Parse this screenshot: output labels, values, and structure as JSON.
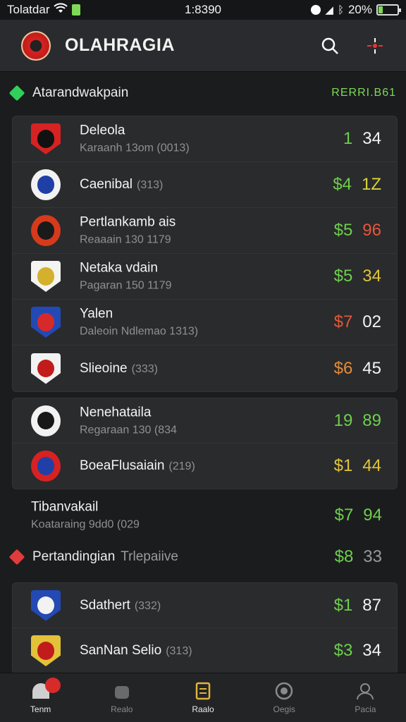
{
  "status_bar": {
    "carrier": "Tolatdar",
    "time": "1:8390",
    "battery": "20%",
    "battery_level": 0.2
  },
  "header": {
    "title": "OLAHRAGIA"
  },
  "sections": [
    {
      "title": "Atarandwakpain",
      "note": "RERRI.B61",
      "color": "#2fd15a"
    },
    {
      "title": "Pertandingian",
      "subtitle": "Trlepaiive",
      "color": "#e23b3b"
    }
  ],
  "group1": [
    {
      "name": "Deleola",
      "sub": "Karaanh 13om (0013)",
      "s1": "1",
      "s2": "34",
      "c1": "#6ccf4c",
      "c2": "#f4f4f4",
      "b1": "#d62222",
      "b2": "#111111",
      "shape": "shield"
    },
    {
      "name": "Caenibal",
      "count": "(313)",
      "s1": "$4",
      "s2": "1Z",
      "c1": "#6ccf4c",
      "c2": "#d8d438",
      "b1": "#f2f2f2",
      "b2": "#1f3fa6",
      "shape": "round"
    },
    {
      "name": "Pertlankamb ais",
      "sub": "Reaaain 130 1179",
      "s1": "$5",
      "s2": "96",
      "c1": "#6ccf4c",
      "c2": "#e4573a",
      "b1": "#d63a1c",
      "b2": "#1a1a1a",
      "shape": "round"
    },
    {
      "name": "Netaka vdain",
      "sub": "Pagaran 150 1179",
      "s1": "$5",
      "s2": "34",
      "c1": "#6ccf4c",
      "c2": "#e0c53a",
      "b1": "#f4f4f0",
      "b2": "#d4b02c",
      "shape": "shield"
    },
    {
      "name": "Yalen",
      "sub": "Daleoin Ndlemao 1313)",
      "s1": "$7",
      "s2": "02",
      "c1": "#e4573a",
      "c2": "#f4f4f4",
      "b1": "#2349b5",
      "b2": "#d62a2a",
      "shape": "shield"
    },
    {
      "name": "Slieoine",
      "count": "(333)",
      "s1": "$6",
      "s2": "45",
      "c1": "#e38b3a",
      "c2": "#f4f4f4",
      "b1": "#f2f2f2",
      "b2": "#c21b1b",
      "shape": "shield"
    }
  ],
  "group2": [
    {
      "name": "Nenehataila",
      "sub": "Regaraan 130 (834",
      "s1": "19",
      "s2": "89",
      "c1": "#6ccf4c",
      "c2": "#6ccf4c",
      "b1": "#f2f2f2",
      "b2": "#181818",
      "shape": "round"
    },
    {
      "name": "BoeaFlusaiain",
      "count": "(219)",
      "s1": "$1",
      "s2": "44",
      "c1": "#e0c53a",
      "c2": "#e0c53a",
      "b1": "#d62222",
      "b2": "#2040a8",
      "shape": "round"
    }
  ],
  "single": {
    "name": "Tibanvakail",
    "sub": "Koataraing 9dd0 (029",
    "s1": "$7",
    "s2": "94",
    "c1": "#6ccf4c",
    "c2": "#6ccf4c"
  },
  "section2_score": {
    "s1": "$8",
    "s2": "33",
    "c1": "#6ccf4c",
    "c2": "#9a9a9a"
  },
  "group3": [
    {
      "name": "Sdathert",
      "count": "(332)",
      "s1": "$1",
      "s2": "87",
      "c1": "#6ccf4c",
      "c2": "#f4f4f4",
      "b1": "#2349b5",
      "b2": "#f2f2f2",
      "shape": "shield"
    },
    {
      "name": "SanNan Selio",
      "count": "(313)",
      "s1": "$3",
      "s2": "34",
      "c1": "#6ccf4c",
      "c2": "#f4f4f4",
      "b1": "#e3c23a",
      "b2": "#c21b1b",
      "shape": "shield"
    }
  ],
  "nav": [
    {
      "label": "Tenm",
      "icon": "home-icon",
      "active": true
    },
    {
      "label": "Realo",
      "icon": "team-icon",
      "active": false
    },
    {
      "label": "Raalo",
      "icon": "schedule-icon",
      "active": true
    },
    {
      "label": "Oegis",
      "icon": "target-icon",
      "active": false
    },
    {
      "label": "Pacia",
      "icon": "profile-icon",
      "active": false
    }
  ]
}
